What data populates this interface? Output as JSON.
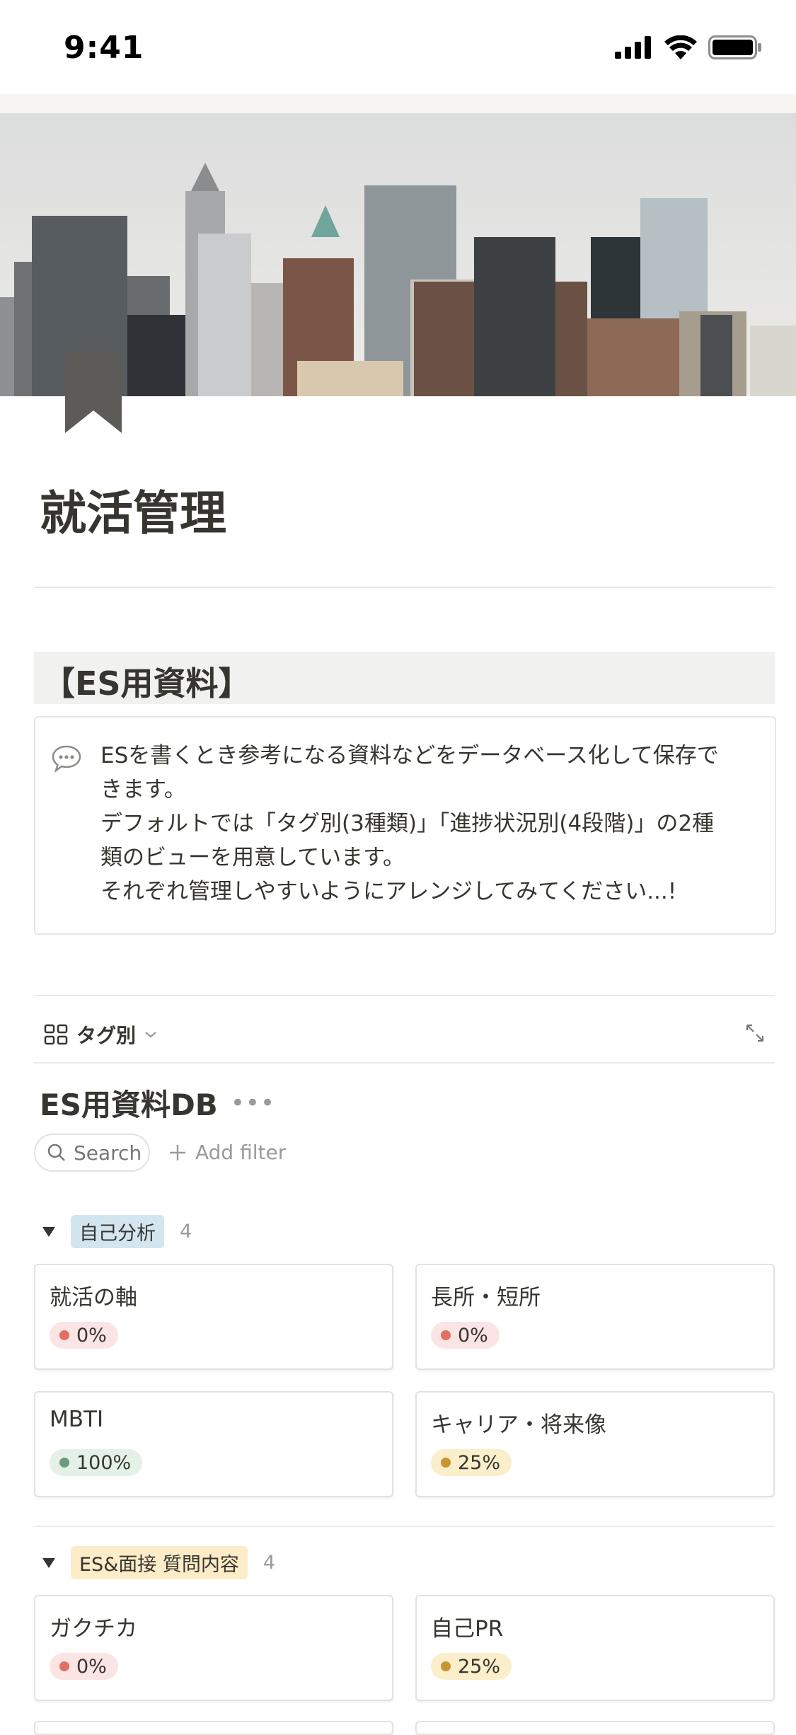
{
  "status_bar": {
    "time": "9:41"
  },
  "page": {
    "title": "就活管理"
  },
  "section": {
    "heading": "【ES用資料】"
  },
  "callout": {
    "lines": [
      "ESを書くとき参考になる資料などをデータベース化して保存で",
      "きます。",
      "デフォルトでは「タグ別(3種類)」「進捗状況別(4段階)」の2種",
      "類のビューを用意しています。",
      "それぞれ管理しやすいようにアレンジしてみてください...!"
    ]
  },
  "view": {
    "tab_label": "タグ別"
  },
  "database": {
    "title": "ES用資料DB",
    "search_label": "Search",
    "add_filter_label": "Add filter"
  },
  "colors": {
    "red_badge_bg": "#fbe4e4",
    "red_dot": "#e16f64",
    "green_badge_bg": "#e4f1e6",
    "green_dot": "#6c9b7d",
    "yellow_badge_bg": "#fbeecb",
    "yellow_dot": "#cb9433",
    "blue_tag_bg": "#d3e5ef",
    "yellow_tag_bg": "#fdecc8"
  },
  "groups": [
    {
      "tag": "自己分析",
      "count": "4",
      "cards": [
        {
          "title": "就活の軸",
          "progress": "0%"
        },
        {
          "title": "長所・短所",
          "progress": "0%"
        },
        {
          "title": "MBTI",
          "progress": "100%"
        },
        {
          "title": "キャリア・将来像",
          "progress": "25%"
        }
      ]
    },
    {
      "tag": "ES&面接 質問内容",
      "count": "4",
      "cards": [
        {
          "title": "ガクチカ",
          "progress": "0%"
        },
        {
          "title": "自己PR",
          "progress": "25%"
        }
      ]
    }
  ]
}
